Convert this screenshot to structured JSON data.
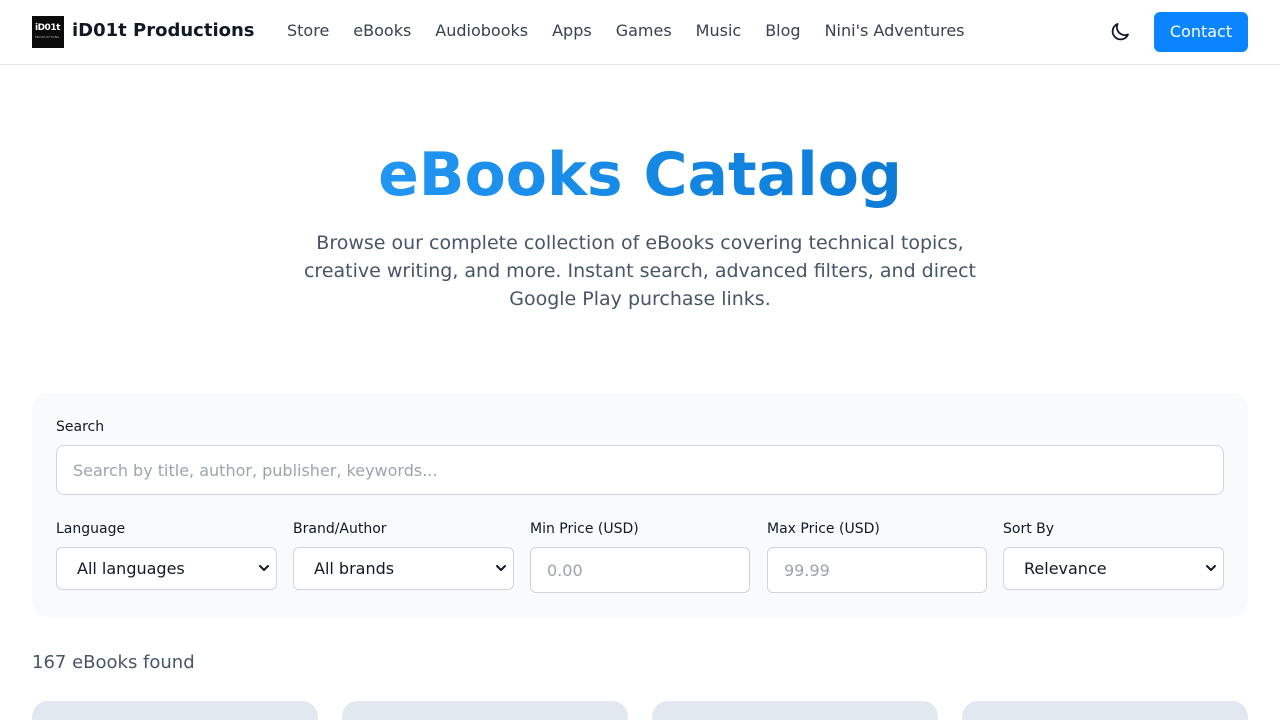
{
  "brand": {
    "logo_line1": "iD01t",
    "logo_line2": "PRODUCTIONS",
    "name": "iD01t Productions"
  },
  "nav": {
    "items": [
      "Store",
      "eBooks",
      "Audiobooks",
      "Apps",
      "Games",
      "Music",
      "Blog",
      "Nini's Adventures"
    ]
  },
  "header": {
    "theme_icon": "moon-icon",
    "contact_label": "Contact"
  },
  "hero": {
    "title": "eBooks Catalog",
    "subtitle": "Browse our complete collection of eBooks covering technical topics, creative writing, and more. Instant search, advanced filters, and direct Google Play purchase links."
  },
  "filters": {
    "search_label": "Search",
    "search_placeholder": "Search by title, author, publisher, keywords...",
    "language_label": "Language",
    "language_value": "All languages",
    "brand_label": "Brand/Author",
    "brand_value": "All brands",
    "min_price_label": "Min Price (USD)",
    "min_price_placeholder": "0.00",
    "max_price_label": "Max Price (USD)",
    "max_price_placeholder": "99.99",
    "sort_label": "Sort By",
    "sort_value": "Relevance"
  },
  "results": {
    "count_text": "167 eBooks found"
  },
  "colors": {
    "accent": "#0a84ff",
    "title_gradient_start": "#2196f3",
    "title_gradient_end": "#0b7bd6",
    "panel_bg": "#f8fafc",
    "card_placeholder": "#e2e8f0"
  }
}
